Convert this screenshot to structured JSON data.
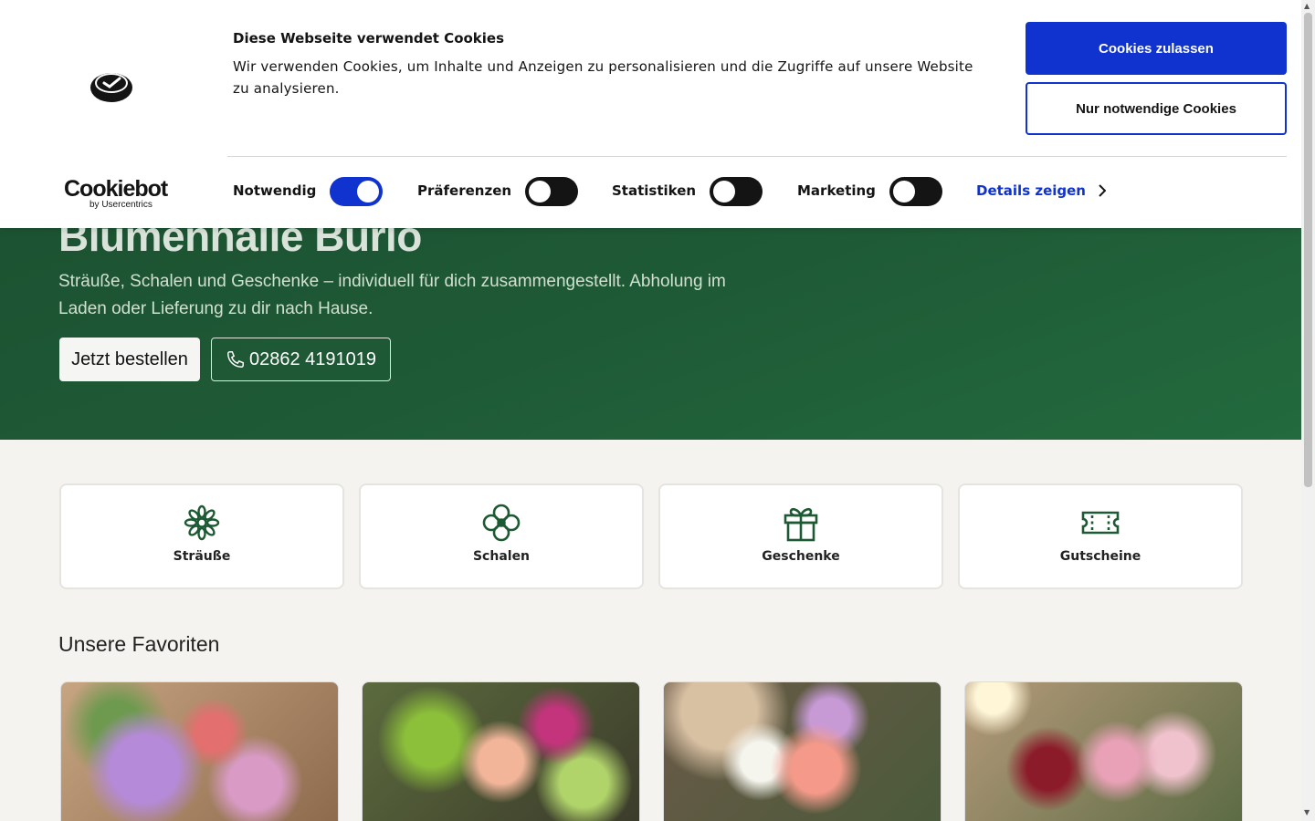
{
  "hero": {
    "title": "Blumenhalle Burlo",
    "subtitle": "Sträuße, Schalen und Geschenke – individuell für dich zusammengestellt. Abholung im Laden oder Lieferung zu dir nach Hause.",
    "order_button": "Jetzt bestellen",
    "phone_button": "02862 4191019"
  },
  "categories": [
    {
      "label": "Sträuße",
      "icon": "flower-icon"
    },
    {
      "label": "Schalen",
      "icon": "clover-flower-icon"
    },
    {
      "label": "Geschenke",
      "icon": "gift-icon"
    },
    {
      "label": "Gutscheine",
      "icon": "ticket-icon"
    }
  ],
  "favorites": {
    "title": "Unsere Favoriten"
  },
  "cookie_banner": {
    "title": "Diese Webseite verwendet Cookies",
    "text": "Wir verwenden Cookies, um Inhalte und Anzeigen zu personalisieren und die Zugriffe auf unsere Website zu analysieren.",
    "allow_button": "Cookies zulassen",
    "necessary_button": "Nur notwendige Cookies",
    "logo_main": "Cookiebot",
    "logo_sub": "by Usercentrics",
    "toggles": [
      {
        "label": "Notwendig",
        "on": true
      },
      {
        "label": "Präferenzen",
        "on": false
      },
      {
        "label": "Statistiken",
        "on": false
      },
      {
        "label": "Marketing",
        "on": false
      }
    ],
    "details_link": "Details zeigen"
  },
  "colors": {
    "accent": "#1032cf",
    "hero_green": "#1e5a36",
    "icon_green": "#1d5a33",
    "background": "#f4f3ef"
  }
}
